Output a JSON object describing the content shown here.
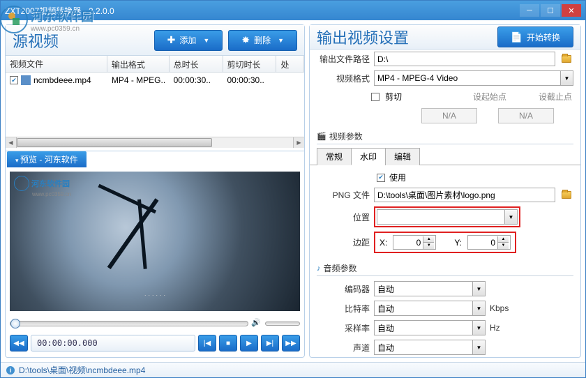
{
  "window": {
    "title": "ZXT2007视频转换器 - 2.2.0.0"
  },
  "watermark": {
    "site_name": "河东软件园",
    "site_url": "www.pc0359.cn"
  },
  "left": {
    "title": "源视频",
    "add_btn": "添加",
    "remove_btn": "删除",
    "columns": {
      "file": "视频文件",
      "format": "输出格式",
      "duration": "总时长",
      "trim": "剪切时长",
      "action": "处"
    },
    "rows": [
      {
        "checked": true,
        "file": "ncmbdeee.mp4",
        "format": "MP4 - MPEG..",
        "duration": "00:00:30..",
        "trim": "00:00:30.."
      }
    ],
    "preview_tab": "预览 - 河东软件",
    "playback_time": "00:00:00.000"
  },
  "right": {
    "title": "输出视频设置",
    "start_btn": "开始转换",
    "output_path_label": "输出文件路径",
    "output_path": "D:\\",
    "video_format_label": "视频格式",
    "video_format": "MP4 - MPEG-4 Video",
    "trim_check": "剪切",
    "trim_start": "设起始点",
    "trim_end": "设截止点",
    "na": "N/A",
    "video_params": "视频参数",
    "tabs": {
      "general": "常规",
      "watermark": "水印",
      "edit": "编辑"
    },
    "wm": {
      "use": "使用",
      "png_label": "PNG 文件",
      "png_path": "D:\\tools\\桌面\\图片素材\\logo.png",
      "position": "位置",
      "margin": "边距",
      "x": "X:",
      "y": "Y:",
      "xv": "0",
      "yv": "0"
    },
    "audio_params": "音频参数",
    "encoder_label": "编码器",
    "bitrate_label": "比特率",
    "samplerate_label": "采样率",
    "channel_label": "声道",
    "auto": "自动",
    "kbps": "Kbps",
    "hz": "Hz"
  },
  "statusbar": {
    "path": "D:\\tools\\桌面\\视频\\ncmbdeee.mp4"
  }
}
